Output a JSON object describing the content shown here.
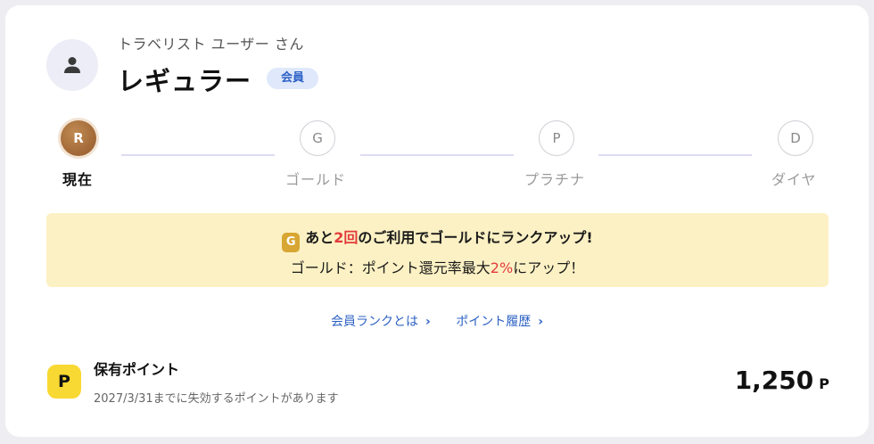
{
  "user": {
    "name": "トラベリスト ユーザー さん",
    "rank": "レギュラー",
    "badge": "会員"
  },
  "steps": [
    {
      "letter": "R",
      "label": "現在",
      "current": true
    },
    {
      "letter": "G",
      "label": "ゴールド",
      "current": false
    },
    {
      "letter": "P",
      "label": "プラチナ",
      "current": false
    },
    {
      "letter": "D",
      "label": "ダイヤ",
      "current": false
    }
  ],
  "banner": {
    "icon_letter": "G",
    "line1_pre": "あと",
    "line1_count": "2回",
    "line1_post": "のご利用でゴールドにランクアップ!",
    "line2_pre": "ゴールド：ポイント還元率最大",
    "line2_rate": "2%",
    "line2_post": "にアップ！"
  },
  "links": {
    "rank_info": "会員ランクとは",
    "point_history": "ポイント履歴"
  },
  "points": {
    "icon_letter": "P",
    "label": "保有ポイント",
    "note": "2027/3/31までに失効するポイントがあります",
    "value": "1,250",
    "unit": "P"
  },
  "colors": {
    "accent_link": "#2e62c4",
    "highlight_red": "#e23b3b",
    "banner_bg": "#fcf1c4",
    "bronze": "#93582a",
    "point_yellow": "#f8d832"
  }
}
